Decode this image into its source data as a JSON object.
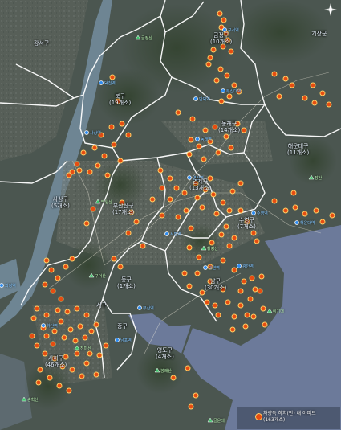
{
  "map": {
    "colors": {
      "land": "#4b5650",
      "mountain": "#3b4a3e",
      "river": "#6e8593",
      "sea": "#6c7a9a",
      "boundary": "#ffffff",
      "marker": "#e64d12",
      "station": "#2e8cf0",
      "mountain_marker": "#3ec26a"
    },
    "district_labels": [
      {
        "id": "d1",
        "lines": [
          "금정구",
          "(10개소)"
        ]
      },
      {
        "id": "d2",
        "lines": [
          "북구",
          "(19개소)"
        ]
      },
      {
        "id": "d3",
        "lines": [
          "동래구",
          "(14개소)"
        ]
      },
      {
        "id": "d4",
        "lines": [
          "해운대구",
          "(11개소)"
        ]
      },
      {
        "id": "d5",
        "lines": [
          "사상구",
          "(5개소)"
        ]
      },
      {
        "id": "d6",
        "lines": [
          "부산진구",
          "(17개소)"
        ]
      },
      {
        "id": "d7",
        "lines": [
          "연제구",
          "(13개소)"
        ]
      },
      {
        "id": "d8",
        "lines": [
          "수영구",
          "(7개소)"
        ]
      },
      {
        "id": "d9",
        "lines": [
          "동구",
          "(1개소)"
        ]
      },
      {
        "id": "d10",
        "lines": [
          "남구",
          "(30개소)"
        ]
      },
      {
        "id": "d11",
        "lines": [
          "서구"
        ]
      },
      {
        "id": "d12",
        "lines": [
          "중구"
        ]
      },
      {
        "id": "d13",
        "lines": [
          "사하구",
          "(46개소)"
        ]
      },
      {
        "id": "d14",
        "lines": [
          "영도구",
          "(4개소)"
        ]
      },
      {
        "id": "d15",
        "lines": [
          "강서구"
        ]
      },
      {
        "id": "d16",
        "lines": [
          "기장군"
        ]
      }
    ],
    "station_labels": [
      "구서역",
      "덕천역",
      "만덕역",
      "부산대역",
      "동래역",
      "사상역",
      "서면역",
      "연산역",
      "수영역",
      "광안역",
      "해운대역",
      "부산역",
      "남포역",
      "대연역",
      "하단역",
      "괴정역"
    ],
    "mountain_labels": [
      "금정산",
      "백양산",
      "황령산",
      "구덕산",
      "천마산",
      "봉래산",
      "이기대",
      "장산",
      "승학산",
      "몰운대"
    ],
    "markers": [
      [
        274,
        17
      ],
      [
        279,
        25
      ],
      [
        276,
        34
      ],
      [
        282,
        42
      ],
      [
        284,
        50
      ],
      [
        278,
        58
      ],
      [
        288,
        64
      ],
      [
        266,
        62
      ],
      [
        260,
        80
      ],
      [
        275,
        86
      ],
      [
        283,
        94
      ],
      [
        270,
        100
      ],
      [
        292,
        106
      ],
      [
        298,
        114
      ],
      [
        286,
        120
      ],
      [
        276,
        126
      ],
      [
        262,
        72
      ],
      [
        140,
        96
      ],
      [
        147,
        126
      ],
      [
        152,
        154
      ],
      [
        139,
        158
      ],
      [
        126,
        168
      ],
      [
        118,
        184
      ],
      [
        104,
        190
      ],
      [
        96,
        204
      ],
      [
        90,
        214
      ],
      [
        112,
        214
      ],
      [
        130,
        194
      ],
      [
        142,
        180
      ],
      [
        160,
        168
      ],
      [
        122,
        206
      ],
      [
        99,
        212
      ],
      [
        86,
        218
      ],
      [
        134,
        218
      ],
      [
        150,
        200
      ],
      [
        222,
        140
      ],
      [
        240,
        148
      ],
      [
        256,
        162
      ],
      [
        268,
        158
      ],
      [
        282,
        170
      ],
      [
        296,
        154
      ],
      [
        304,
        162
      ],
      [
        262,
        176
      ],
      [
        248,
        182
      ],
      [
        236,
        192
      ],
      [
        272,
        190
      ],
      [
        288,
        184
      ],
      [
        254,
        198
      ],
      [
        238,
        174
      ],
      [
        342,
        92
      ],
      [
        356,
        98
      ],
      [
        364,
        106
      ],
      [
        380,
        122
      ],
      [
        392,
        128
      ],
      [
        402,
        116
      ],
      [
        390,
        106
      ],
      [
        348,
        120
      ],
      [
        410,
        130
      ],
      [
        200,
        212
      ],
      [
        212,
        222
      ],
      [
        220,
        234
      ],
      [
        230,
        240
      ],
      [
        244,
        228
      ],
      [
        256,
        236
      ],
      [
        266,
        242
      ],
      [
        278,
        252
      ],
      [
        290,
        238
      ],
      [
        300,
        228
      ],
      [
        212,
        248
      ],
      [
        232,
        262
      ],
      [
        252,
        258
      ],
      [
        270,
        266
      ],
      [
        286,
        262
      ],
      [
        262,
        222
      ],
      [
        246,
        246
      ],
      [
        202,
        234
      ],
      [
        222,
        270
      ],
      [
        238,
        284
      ],
      [
        300,
        262
      ],
      [
        308,
        276
      ],
      [
        316,
        290
      ],
      [
        282,
        282
      ],
      [
        292,
        296
      ],
      [
        276,
        292
      ],
      [
        264,
        302
      ],
      [
        320,
        300
      ],
      [
        286,
        306
      ],
      [
        342,
        250
      ],
      [
        356,
        262
      ],
      [
        368,
        258
      ],
      [
        380,
        266
      ],
      [
        394,
        262
      ],
      [
        402,
        276
      ],
      [
        414,
        268
      ],
      [
        366,
        240
      ],
      [
        190,
        248
      ],
      [
        202,
        268
      ],
      [
        170,
        276
      ],
      [
        160,
        290
      ],
      [
        178,
        306
      ],
      [
        164,
        264
      ],
      [
        152,
        252
      ],
      [
        116,
        260
      ],
      [
        108,
        278
      ],
      [
        236,
        308
      ],
      [
        248,
        320
      ],
      [
        262,
        332
      ],
      [
        278,
        324
      ],
      [
        292,
        336
      ],
      [
        304,
        350
      ],
      [
        318,
        360
      ],
      [
        312,
        372
      ],
      [
        300,
        380
      ],
      [
        292,
        394
      ],
      [
        306,
        406
      ],
      [
        316,
        394
      ],
      [
        328,
        384
      ],
      [
        324,
        362
      ],
      [
        326,
        344
      ],
      [
        246,
        340
      ],
      [
        262,
        350
      ],
      [
        278,
        360
      ],
      [
        236,
        356
      ],
      [
        252,
        364
      ],
      [
        268,
        380
      ],
      [
        284,
        376
      ],
      [
        300,
        362
      ],
      [
        314,
        346
      ],
      [
        230,
        340
      ],
      [
        258,
        376
      ],
      [
        272,
        392
      ],
      [
        290,
        410
      ],
      [
        308,
        392
      ],
      [
        330,
        404
      ],
      [
        142,
        322
      ],
      [
        150,
        332
      ],
      [
        58,
        324
      ],
      [
        64,
        336
      ],
      [
        72,
        346
      ],
      [
        82,
        332
      ],
      [
        90,
        322
      ],
      [
        56,
        354
      ],
      [
        66,
        362
      ],
      [
        76,
        372
      ],
      [
        84,
        388
      ],
      [
        96,
        384
      ],
      [
        108,
        392
      ],
      [
        100,
        406
      ],
      [
        88,
        410
      ],
      [
        76,
        400
      ],
      [
        68,
        412
      ],
      [
        54,
        408
      ],
      [
        42,
        396
      ],
      [
        46,
        384
      ],
      [
        58,
        392
      ],
      [
        72,
        386
      ],
      [
        80,
        420
      ],
      [
        94,
        424
      ],
      [
        106,
        420
      ],
      [
        114,
        412
      ],
      [
        120,
        404
      ],
      [
        46,
        430
      ],
      [
        56,
        440
      ],
      [
        68,
        446
      ],
      [
        78,
        456
      ],
      [
        90,
        460
      ],
      [
        102,
        468
      ],
      [
        62,
        470
      ],
      [
        74,
        480
      ],
      [
        86,
        486
      ],
      [
        50,
        460
      ],
      [
        58,
        418
      ],
      [
        112,
        440
      ],
      [
        124,
        442
      ],
      [
        132,
        430
      ],
      [
        40,
        418
      ],
      [
        66,
        428
      ],
      [
        82,
        444
      ],
      [
        96,
        440
      ],
      [
        108,
        452
      ],
      [
        120,
        466
      ],
      [
        48,
        476
      ],
      [
        216,
        470
      ],
      [
        234,
        458
      ],
      [
        244,
        492
      ],
      [
        238,
        506
      ]
    ],
    "legend": {
      "marker_icon": "marker-dot",
      "lines": [
        "차량독 하치(만) 내 아파트",
        "(163개소)"
      ]
    }
  }
}
